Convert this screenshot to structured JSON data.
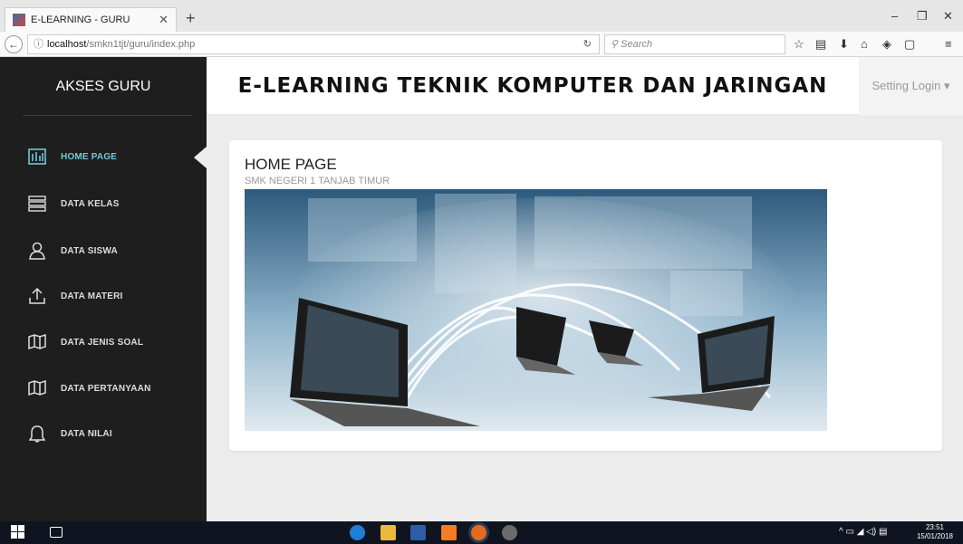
{
  "browser": {
    "tab_title": "E-LEARNING - GURU",
    "tab_close": "✕",
    "new_tab": "+",
    "url_host": "localhost",
    "url_path": "/smkn1tjt/guru/index.php",
    "search_placeholder": "Search",
    "window_controls": {
      "minimize": "–",
      "restore": "❐",
      "close": "✕"
    }
  },
  "sidebar": {
    "brand": "AKSES GURU",
    "items": [
      {
        "label": "HOME PAGE",
        "icon": "chart-icon",
        "active": true
      },
      {
        "label": "DATA KELAS",
        "icon": "server-icon"
      },
      {
        "label": "DATA SISWA",
        "icon": "user-icon"
      },
      {
        "label": "DATA MATERI",
        "icon": "upload-icon"
      },
      {
        "label": "DATA JENIS SOAL",
        "icon": "map-icon"
      },
      {
        "label": "DATA PERTANYAAN",
        "icon": "map-icon"
      },
      {
        "label": "DATA NILAI",
        "icon": "bell-icon"
      }
    ]
  },
  "header": {
    "title": "E-LEARNING TEKNIK KOMPUTER DAN JARINGAN",
    "setting": "Setting Login ▾"
  },
  "main": {
    "card_title": "HOME PAGE",
    "card_subtitle": "SMK NEGERI 1 TANJAB TIMUR"
  },
  "taskbar": {
    "time": "23:51",
    "date": "15/01/2018"
  },
  "colors": {
    "sidebar_bg": "#1e1e1e",
    "active_menu": "#73c6d8",
    "taskbar_bg": "#0f1420"
  }
}
